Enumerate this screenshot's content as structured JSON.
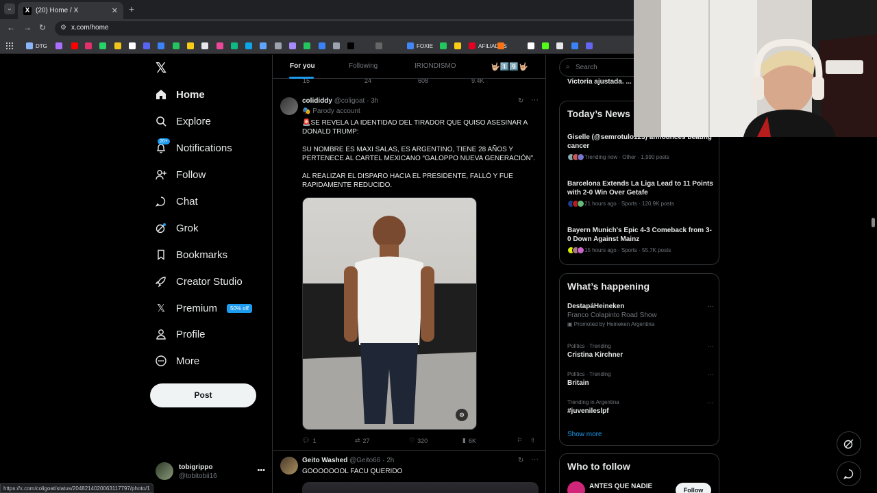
{
  "browser": {
    "tab_title": "(20) Home / X",
    "url": "x.com/home",
    "bookmarks": [
      {
        "label": "DTG",
        "color": "#8ab4f8"
      },
      {
        "label": "",
        "color": "#a970ff"
      },
      {
        "label": "",
        "color": "#ff0000"
      },
      {
        "label": "",
        "color": "#e1306c"
      },
      {
        "label": "",
        "color": "#25d366"
      },
      {
        "label": "",
        "color": "#f0c419"
      },
      {
        "label": "",
        "color": "#ffffff"
      },
      {
        "label": "",
        "color": "#5865f2"
      },
      {
        "label": "",
        "color": "#3b82f6"
      },
      {
        "label": "",
        "color": "#22c55e"
      },
      {
        "label": "",
        "color": "#facc15"
      },
      {
        "label": "",
        "color": "#e5e7eb"
      },
      {
        "label": "",
        "color": "#ec4899"
      },
      {
        "label": "",
        "color": "#10b981"
      },
      {
        "label": "",
        "color": "#0ea5e9"
      },
      {
        "label": "",
        "color": "#60a5fa"
      },
      {
        "label": "",
        "color": "#9ca3af"
      },
      {
        "label": "",
        "color": "#a78bfa"
      },
      {
        "label": "",
        "color": "#22c55e"
      },
      {
        "label": "",
        "color": "#3b82f6"
      },
      {
        "label": "",
        "color": "#9ca3af"
      },
      {
        "label": "",
        "color": "#000000"
      },
      {
        "label": "",
        "color": "#666666"
      },
      {
        "label": "FOXIE",
        "color": "#4285f4"
      },
      {
        "label": "",
        "color": "#22c55e"
      },
      {
        "label": "",
        "color": "#facc15"
      },
      {
        "label": "AFILIADOS",
        "color": "#e60023"
      },
      {
        "label": "",
        "color": "#f97316"
      },
      {
        "label": "",
        "color": "#ffffff"
      },
      {
        "label": "",
        "color": "#53fc18"
      },
      {
        "label": "",
        "color": "#e5e7eb"
      },
      {
        "label": "",
        "color": "#3b82f6"
      },
      {
        "label": "",
        "color": "#6366f1"
      }
    ],
    "status_url": "https://x.com/coligoat/status/2048214020063117797/photo/1"
  },
  "nav": {
    "items": [
      {
        "label": "Home",
        "icon": "home-icon"
      },
      {
        "label": "Explore",
        "icon": "search-icon"
      },
      {
        "label": "Notifications",
        "icon": "bell-icon",
        "badge": "20+"
      },
      {
        "label": "Follow",
        "icon": "follow-icon"
      },
      {
        "label": "Chat",
        "icon": "chat-icon"
      },
      {
        "label": "Grok",
        "icon": "grok-icon"
      },
      {
        "label": "Bookmarks",
        "icon": "bookmark-icon"
      },
      {
        "label": "Creator Studio",
        "icon": "rocket-icon"
      },
      {
        "label": "Premium",
        "icon": "x-icon",
        "badge": "50% off"
      },
      {
        "label": "Profile",
        "icon": "person-icon"
      },
      {
        "label": "More",
        "icon": "more-icon"
      }
    ],
    "post_label": "Post",
    "account": {
      "name": "tobigrippo",
      "handle": "@tobitobii16"
    }
  },
  "feed": {
    "tabs": [
      "For you",
      "Following",
      "IRIONDISMO",
      "🤟🏼1️⃣9️⃣🤟🏼"
    ],
    "prev_actions": {
      "replies": "15",
      "reposts": "24",
      "likes": "608",
      "views": "9.4K"
    },
    "tweet1": {
      "name": "colididdy",
      "handle": "@coligoat",
      "time": "3h",
      "parody": "Parody account",
      "lines": [
        "🚨SE REVELA LA IDENTIDAD DEL TIRADOR QUE QUISO ASESINAR A DONALD TRUMP:",
        "SU NOMBRE ES MAXI SALAS, ES ARGENTINO, TIENE 28 AÑOS Y PERTENECE AL CARTEL MEXICANO “GALOPPO NUEVA GENERACIÓN”.",
        "AL REALIZAR EL DISPARO HACIA EL PRESIDENTE, FALLÓ Y FUE RAPIDAMENTE REDUCIDO."
      ],
      "replies": "1",
      "reposts": "27",
      "likes": "320",
      "views": "6K"
    },
    "tweet2": {
      "name": "Geito Washed",
      "handle": "@Geito66",
      "time": "2h",
      "text": "GOOOOOOOL FACU QUERIDO"
    }
  },
  "right": {
    "search_placeholder": "Search",
    "prev_trend": "Victoria ajustada. ...",
    "news_title": "Today’s News",
    "news": [
      {
        "headline": "Giselle (@semrotulo123) announces beating cancer",
        "meta": "Trending now · Other · 1,990 posts"
      },
      {
        "headline": "Barcelona Extends La Liga Lead to 11 Points with 2-0 Win Over Getafe",
        "meta": "21 hours ago · Sports · 120.9K posts"
      },
      {
        "headline": "Bayern Munich's Epic 4-3 Comeback from 3-0 Down Against Mainz",
        "meta": "15 hours ago · Sports · 55.7K posts"
      }
    ],
    "happening_title": "What’s happening",
    "trends": [
      {
        "context": "",
        "title": "DestapáHeineken",
        "sub": "Franco Colapinto Road Show",
        "promo": "Promoted by Heineken Argentina"
      },
      {
        "context": "Politics · Trending",
        "title": "Cristina Kirchner"
      },
      {
        "context": "Politics · Trending",
        "title": "Britain"
      },
      {
        "context": "Trending in Argentina",
        "title": "#juvenileslpf"
      }
    ],
    "show_more": "Show more",
    "wtf_title": "Who to follow",
    "wtf": {
      "name": "ANTES QUE NADIE",
      "button": "Follow"
    }
  }
}
